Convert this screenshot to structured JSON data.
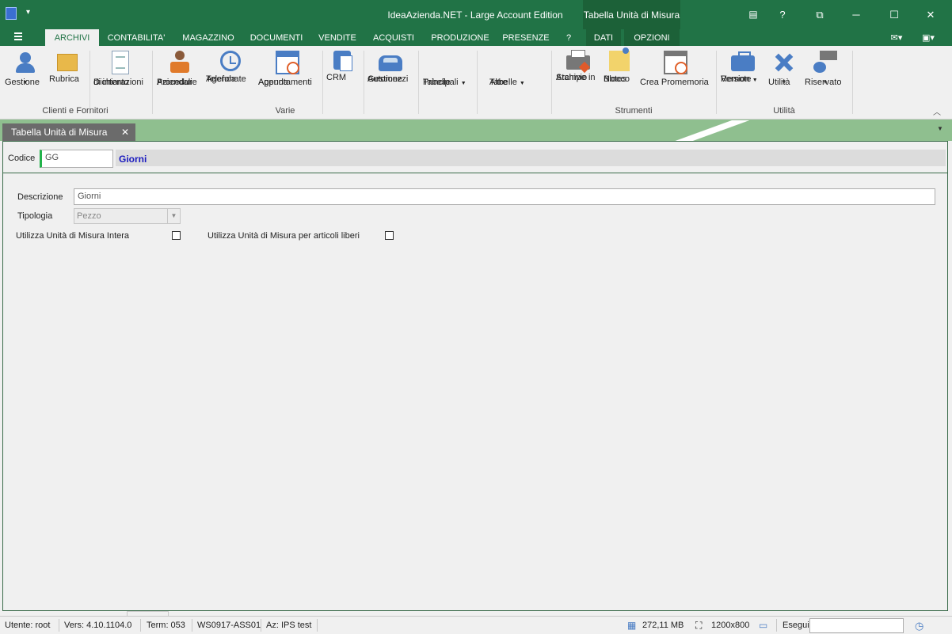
{
  "window": {
    "title": "IdeaAzienda.NET - Large Account Edition",
    "context_tab_title": "Tabella Unità di Misura",
    "controls": {
      "help": "?",
      "minimize": "─",
      "maximize": "☐",
      "close": "✕"
    }
  },
  "ribbon_tabs": [
    {
      "label": "ARCHIVI",
      "active": true
    },
    {
      "label": "CONTABILITA'"
    },
    {
      "label": "MAGAZZINO"
    },
    {
      "label": "DOCUMENTI"
    },
    {
      "label": "VENDITE"
    },
    {
      "label": "ACQUISTI"
    },
    {
      "label": "PRODUZIONE"
    },
    {
      "label": "PRESENZE"
    },
    {
      "label": "?"
    },
    {
      "label": "DATI"
    },
    {
      "label": "OPZIONI"
    }
  ],
  "ribbon": {
    "buttons": {
      "gestione": {
        "line1": "Gestione",
        "line2": "",
        "icon": "people-icon"
      },
      "rubrica": {
        "line1": "Rubrica",
        "line2": "",
        "icon": "box-icon"
      },
      "dichiarazioni": {
        "line1": "Dichiarazioni",
        "line2": "di intento",
        "icon": "document-icon"
      },
      "procedure": {
        "line1": "Procedure",
        "line2": "Aziendali",
        "icon": "person-icon"
      },
      "agenda_tel": {
        "line1": "Agenda",
        "line2": "Telefonate",
        "icon": "clock-icon"
      },
      "agenda_app": {
        "line1": "Agenda",
        "line2": "Appuntamenti",
        "icon": "calendar-icon"
      },
      "crm": {
        "line1": "CRM",
        "line2": "",
        "icon": "crm-icon"
      },
      "automezzi": {
        "line1": "Gestione",
        "line2": "Automezzi",
        "icon": "car-icon"
      },
      "tabelle": {
        "line1": "Tabelle",
        "line2": "Principali",
        "icon": ""
      },
      "altre": {
        "line1": "Altre",
        "line2": "Tabelle",
        "icon": ""
      },
      "stampe": {
        "line1": "Stampe in",
        "line2": "Archivio",
        "icon": "printer-icon"
      },
      "blocco": {
        "line1": "Blocco",
        "line2": "Notes",
        "icon": "notes-icon"
      },
      "promemoria": {
        "line1": "Crea Promemoria",
        "line2": "",
        "icon": "reminder-icon"
      },
      "remote": {
        "line1": "Remote",
        "line2": "Version",
        "icon": "briefcase-icon"
      },
      "utilita": {
        "line1": "Utilità",
        "line2": "",
        "icon": "tools-icon"
      },
      "riservato": {
        "line1": "Riservato",
        "line2": "",
        "icon": "reserved-icon"
      }
    },
    "groups": {
      "clienti": "Clienti e Fornitori",
      "varie": "Varie",
      "strumenti": "Strumenti",
      "utilita": "Utilità"
    }
  },
  "document_tab": {
    "label": "Tabella Unità di Misura",
    "close": "✕"
  },
  "form": {
    "codice_label": "Codice",
    "codice_value": "GG",
    "codice_description": "Giorni",
    "descrizione_label": "Descrizione",
    "descrizione_value": "Giorni",
    "tipologia_label": "Tipologia",
    "tipologia_value": "Pezzo",
    "intera_label": "Utilizza Unità di Misura Intera",
    "intera_checked": false,
    "liberi_label": "Utilizza Unità di Misura per articoli liberi",
    "liberi_checked": false
  },
  "statusbar": {
    "utente": "Utente: root",
    "versione": "Vers: 4.10.1104.0",
    "term": "Term: 053",
    "ws": "WS0917-ASS01",
    "az": "Az: IPS test",
    "memory": "272,11 MB",
    "resolution": "1200x800",
    "esegui": "Esegui"
  },
  "colors": {
    "accent": "#217346",
    "doc_strip": "#8fbf8f",
    "required_marker": "#21b24a",
    "code_desc_text": "#1a1abf"
  }
}
